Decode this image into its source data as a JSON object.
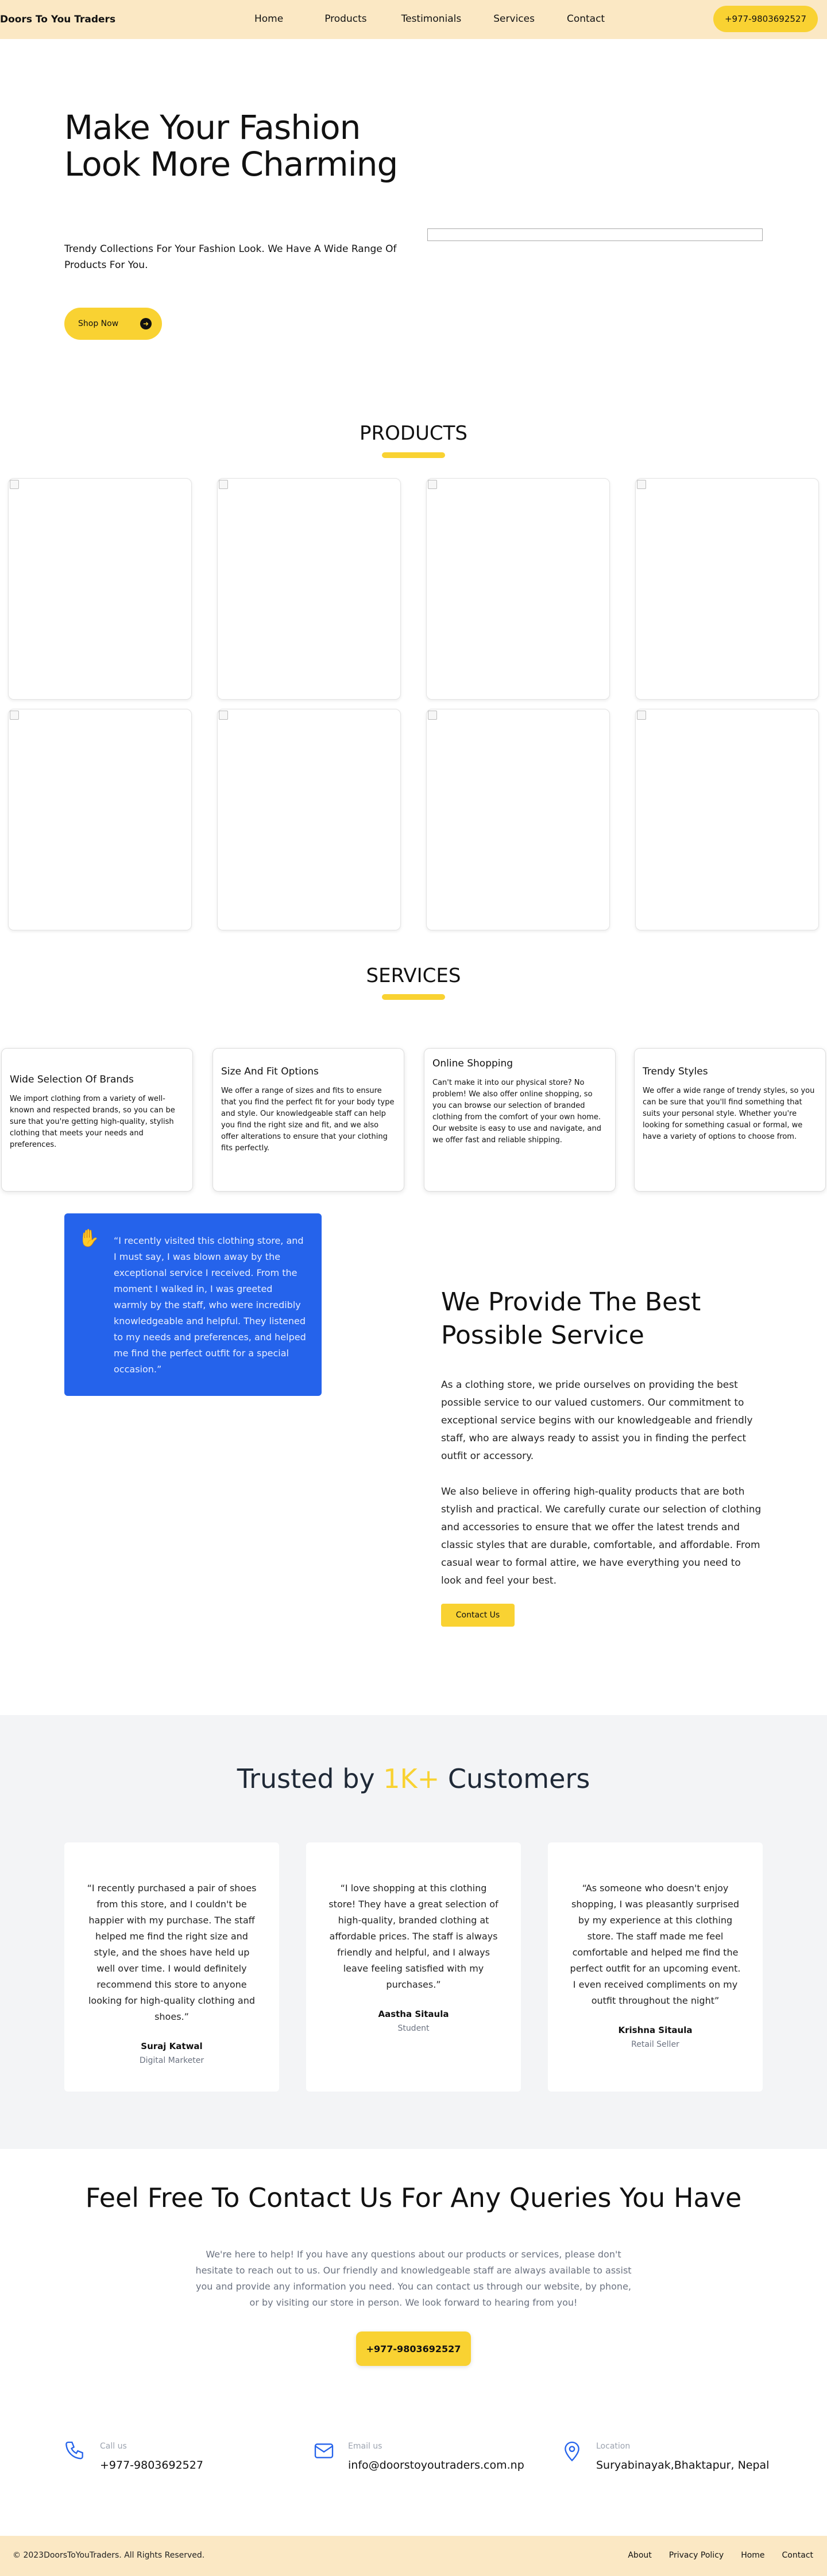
{
  "nav": {
    "brand": "Doors To You Traders",
    "links": [
      "Home",
      "Products",
      "Testimonials",
      "Services",
      "Contact"
    ],
    "phone": "+977-9803692527"
  },
  "hero": {
    "title": "Make Your Fashion Look More Charming",
    "subtitle": "Trendy Collections For Your Fashion Look. We Have A Wide Range Of Products For You.",
    "cta": "Shop Now"
  },
  "products": {
    "title": "PRODUCTS",
    "count": 8
  },
  "services": {
    "title": "SERVICES",
    "items": [
      {
        "title": "Wide Selection Of Brands",
        "text": "We import clothing from a variety of well-known and respected brands, so you can be sure that you're getting high-quality, stylish clothing that meets your needs and preferences."
      },
      {
        "title": "Size And Fit Options",
        "text": "We offer a range of sizes and fits to ensure that you find the perfect fit for your body type and style. Our knowledgeable staff can help you find the right size and fit, and we also offer alterations to ensure that your clothing fits perfectly."
      },
      {
        "title": "Online Shopping",
        "text": "Can't make it into our physical store? No problem! We also offer online shopping, so you can browse our selection of branded clothing from the comfort of your own home. Our website is easy to use and navigate, and we offer fast and reliable shipping."
      },
      {
        "title": "Trendy Styles",
        "text": "We offer a wide range of trendy styles, so you can be sure that you'll find something that suits your personal style. Whether you're looking for something casual or formal, we have a variety of options to choose from."
      }
    ]
  },
  "provide": {
    "quote": "“I recently visited this clothing store, and I must say, I was blown away by the exceptional service I received. From the moment I walked in, I was greeted warmly by the staff, who were incredibly knowledgeable and helpful. They listened to my needs and preferences, and helped me find the perfect outfit for a special occasion.”",
    "title": "We Provide The Best Possible Service",
    "p1": "As a clothing store, we pride ourselves on providing the best possible service to our valued customers. Our commitment to exceptional service begins with our knowledgeable and friendly staff, who are always ready to assist you in finding the perfect outfit or accessory.",
    "p2": "We also believe in offering high-quality products that are both stylish and practical. We carefully curate our selection of clothing and accessories to ensure that we offer the latest trends and classic styles that are durable, comfortable, and affordable. From casual wear to formal attire, we have everything you need to look and feel your best.",
    "cta": "Contact Us"
  },
  "trusted": {
    "title_pre": "Trusted by ",
    "title_accent": "1K+",
    "title_post": " Customers",
    "items": [
      {
        "quote": "“I recently purchased a pair of shoes from this store, and I couldn't be happier with my purchase. The staff helped me find the right size and style, and the shoes have held up well over time. I would definitely recommend this store to anyone looking for high-quality clothing and shoes.”",
        "name": "Suraj Katwal",
        "role": "Digital Marketer"
      },
      {
        "quote": "“I love shopping at this clothing store! They have a great selection of high-quality, branded clothing at affordable prices. The staff is always friendly and helpful, and I always leave feeling satisfied with my purchases.”",
        "name": "Aastha Sitaula",
        "role": "Student"
      },
      {
        "quote": "“As someone who doesn't enjoy shopping, I was pleasantly surprised by my experience at this clothing store. The staff made me feel comfortable and helped me find the perfect outfit for an upcoming event. I even received compliments on my outfit throughout the night”",
        "name": "Krishna Sitaula",
        "role": "Retail Seller"
      }
    ]
  },
  "cta": {
    "title": "Feel Free To Contact Us For Any Queries You Have",
    "text": "We're here to help! If you have any questions about our products or services, please don't hesitate to reach out to us. Our friendly and knowledgeable staff are always available to assist you and provide any information you need. You can contact us through our website, by phone, or by visiting our store in person. We look forward to hearing from you!",
    "phone": "+977-9803692527"
  },
  "contact_info": [
    {
      "label": "Call us",
      "value": "+977-9803692527",
      "icon": "phone-icon"
    },
    {
      "label": "Email us",
      "value": "info@doorstoyoutraders.com.np",
      "icon": "mail-icon"
    },
    {
      "label": "Location",
      "value": "Suryabinayak,Bhaktapur, Nepal",
      "icon": "location-icon"
    }
  ],
  "footer": {
    "copyright": "© 2023DoorsToYouTraders. All Rights Reserved.",
    "links": [
      "About",
      "Privacy Policy",
      "Home",
      "Contact"
    ]
  },
  "colors": {
    "accent": "#f9d232",
    "nav_bg": "#fbe8c4",
    "blue": "#2563eb"
  }
}
